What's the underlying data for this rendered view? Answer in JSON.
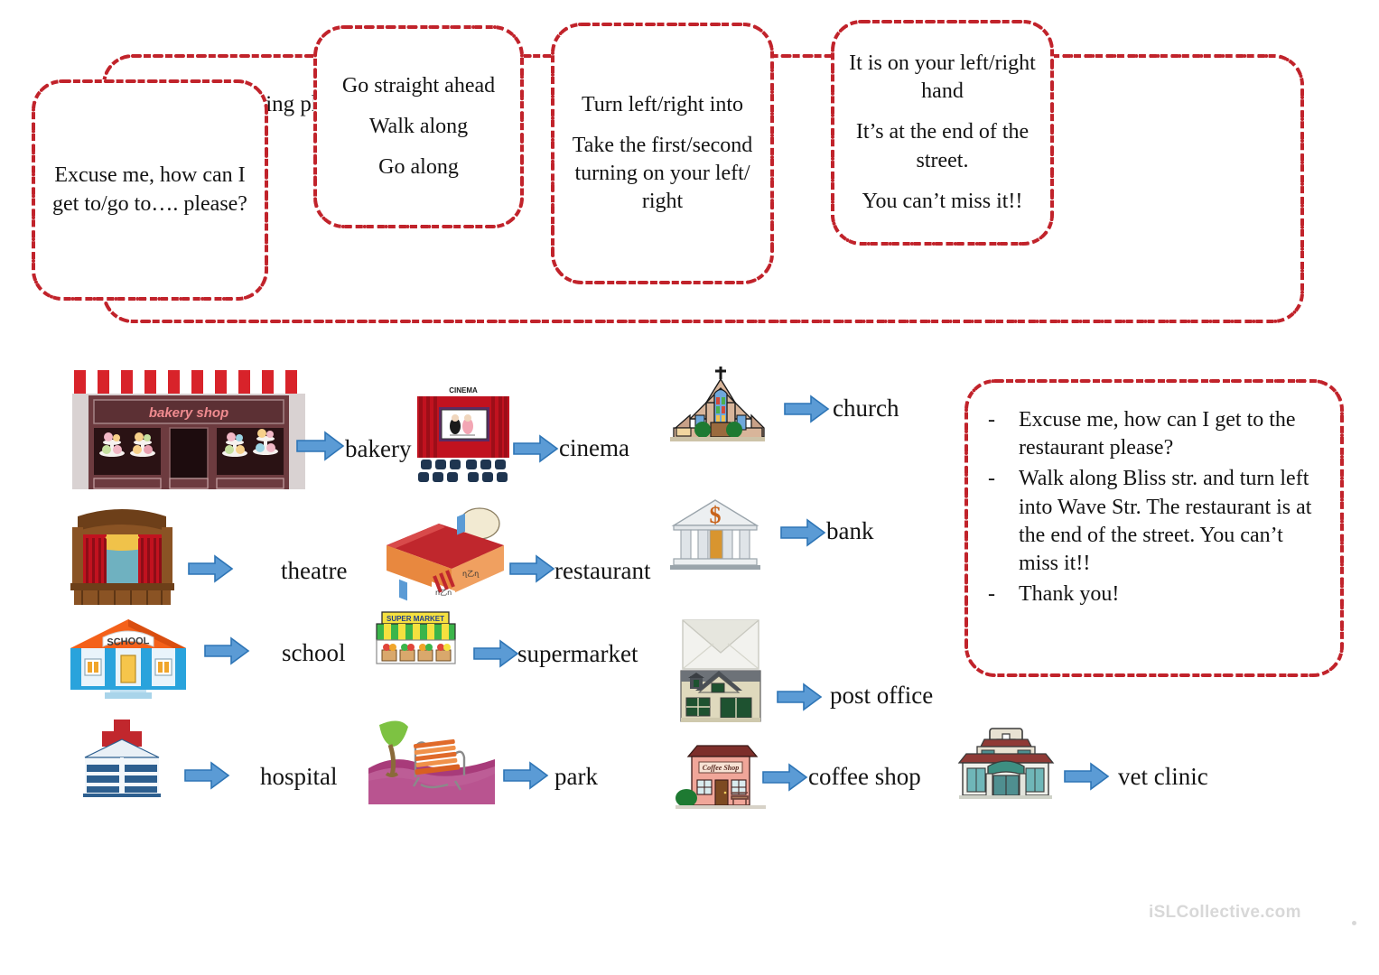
{
  "phrase_banner": {
    "title": "Use the following phrases.",
    "boxes": [
      {
        "lines": [
          "Excuse me, how can I get to/go to…. please?"
        ]
      },
      {
        "lines": [
          "Go straight ahead",
          "Walk along",
          "Go along"
        ]
      },
      {
        "lines": [
          "Turn left/right into",
          "Take the first/second turning on your left/ right"
        ]
      },
      {
        "lines": [
          "It is on your left/right hand",
          "It’s at the end of the street.",
          "You can’t miss it!!"
        ]
      }
    ]
  },
  "dialogue": {
    "dash": "-",
    "lines": [
      "Excuse me, how can I get to the restaurant please?",
      "Walk along Bliss str. and turn left into Wave Str. The restaurant is at the end of the street. You can’t miss it!!",
      "Thank you!"
    ]
  },
  "vocabulary": [
    {
      "label": "bakery",
      "icon": "bakery-shop-illustration",
      "sign": "bakery shop"
    },
    {
      "label": "cinema",
      "icon": "cinema-illustration",
      "sign": "CINEMA"
    },
    {
      "label": "church",
      "icon": "church-illustration",
      "sign": ""
    },
    {
      "label": "theatre",
      "icon": "theatre-stage-illustration",
      "sign": ""
    },
    {
      "label": "restaurant",
      "icon": "restaurant-illustration",
      "sign": ""
    },
    {
      "label": "bank",
      "icon": "bank-illustration",
      "sign": "$"
    },
    {
      "label": "school",
      "icon": "school-illustration",
      "sign": "SCHOOL"
    },
    {
      "label": "supermarket",
      "icon": "supermarket-illustration",
      "sign": "SUPER MARKET"
    },
    {
      "label": "post office",
      "icon": "post-office-illustration",
      "sign": ""
    },
    {
      "label": "hospital",
      "icon": "hospital-illustration",
      "sign": ""
    },
    {
      "label": "park",
      "icon": "park-illustration",
      "sign": ""
    },
    {
      "label": "coffee shop",
      "icon": "coffee-shop-illustration",
      "sign": "Coffee Shop"
    },
    {
      "label": "vet clinic",
      "icon": "vet-clinic-illustration",
      "sign": ""
    }
  ],
  "footer": {
    "watermark": "iSLCollective.com"
  },
  "colors": {
    "border_red": "#c1232b",
    "arrow_blue": "#5b9bd5",
    "arrow_outline": "#2e75b6",
    "text": "#141414",
    "watermark": "#d8d8d8"
  }
}
